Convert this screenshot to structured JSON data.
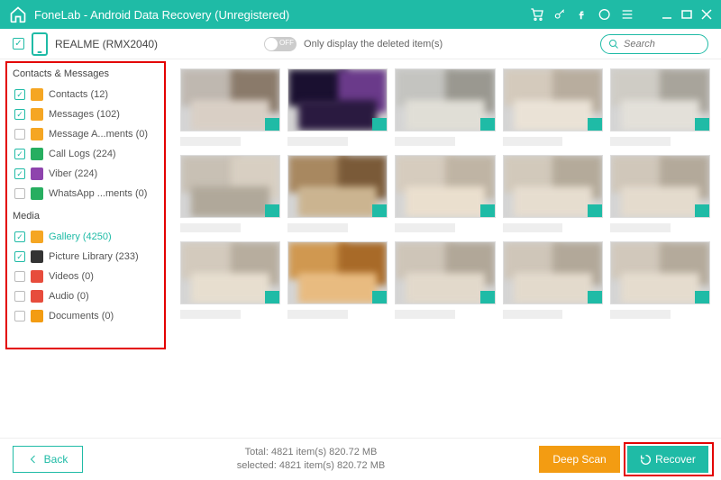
{
  "titlebar": {
    "title": "FoneLab - Android Data Recovery (Unregistered)"
  },
  "subbar": {
    "device": "REALME (RMX2040)",
    "toggle_off": "OFF",
    "toggle_label": "Only display the deleted item(s)",
    "search_placeholder": "Search"
  },
  "sidebar": {
    "group1": "Contacts & Messages",
    "group2": "Media",
    "items": [
      {
        "label": "Contacts (12)",
        "checked": true,
        "icon_bg": "#f5a623",
        "icon": "contacts-icon"
      },
      {
        "label": "Messages (102)",
        "checked": true,
        "icon_bg": "#f5a623",
        "icon": "messages-icon"
      },
      {
        "label": "Message A...ments (0)",
        "checked": false,
        "icon_bg": "#f5a623",
        "icon": "attachments-icon"
      },
      {
        "label": "Call Logs (224)",
        "checked": true,
        "icon_bg": "#27ae60",
        "icon": "calllogs-icon"
      },
      {
        "label": "Viber (224)",
        "checked": true,
        "icon_bg": "#8e44ad",
        "icon": "viber-icon"
      },
      {
        "label": "WhatsApp ...ments (0)",
        "checked": false,
        "icon_bg": "#27ae60",
        "icon": "whatsapp-icon"
      }
    ],
    "media": [
      {
        "label": "Gallery (4250)",
        "checked": true,
        "active": true,
        "icon_bg": "#f5a623",
        "icon": "gallery-icon"
      },
      {
        "label": "Picture Library (233)",
        "checked": true,
        "icon_bg": "#333",
        "icon": "picture-icon"
      },
      {
        "label": "Videos (0)",
        "checked": false,
        "icon_bg": "#e74c3c",
        "icon": "videos-icon"
      },
      {
        "label": "Audio (0)",
        "checked": false,
        "icon_bg": "#e74c3c",
        "icon": "audio-icon"
      },
      {
        "label": "Documents (0)",
        "checked": false,
        "icon_bg": "#f39c12",
        "icon": "documents-icon"
      }
    ]
  },
  "footer": {
    "back": "Back",
    "total": "Total: 4821 item(s) 820.72 MB",
    "selected": "selected: 4821 item(s) 820.72 MB",
    "deep_scan": "Deep Scan",
    "recover": "Recover"
  },
  "thumbs_count": 15
}
